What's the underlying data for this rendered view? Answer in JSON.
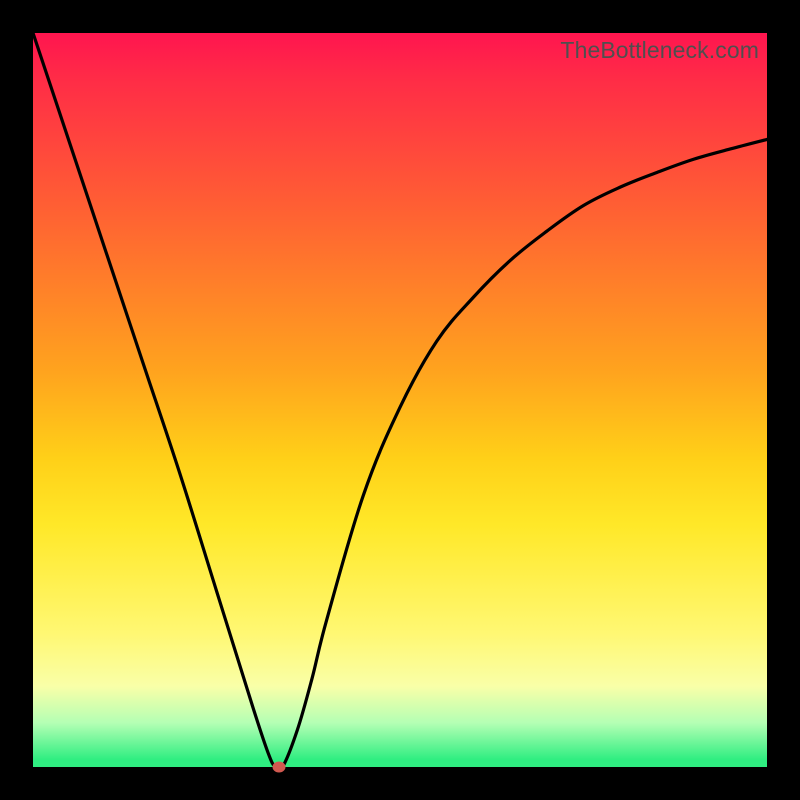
{
  "watermark": "TheBottleneck.com",
  "colors": {
    "background": "#000000",
    "curve": "#000000",
    "marker": "#d15950",
    "gradient_top": "#ff154f",
    "gradient_bottom": "#2fee81"
  },
  "chart_data": {
    "type": "line",
    "title": "",
    "xlabel": "",
    "ylabel": "",
    "xlim": [
      0,
      100
    ],
    "ylim": [
      0,
      100
    ],
    "series": [
      {
        "name": "bottleneck-curve",
        "x": [
          0,
          5,
          10,
          15,
          20,
          25,
          30,
          32,
          33,
          34,
          36,
          38,
          40,
          45,
          50,
          55,
          60,
          65,
          70,
          75,
          80,
          85,
          90,
          95,
          100
        ],
        "values": [
          100,
          85,
          70,
          55,
          40,
          24,
          8,
          2,
          0,
          0,
          5,
          12,
          20,
          37,
          49,
          58,
          64,
          69,
          73,
          76.5,
          79,
          81,
          82.8,
          84.2,
          85.5
        ]
      }
    ],
    "marker": {
      "x": 33.5,
      "y": 0
    },
    "annotations": []
  }
}
